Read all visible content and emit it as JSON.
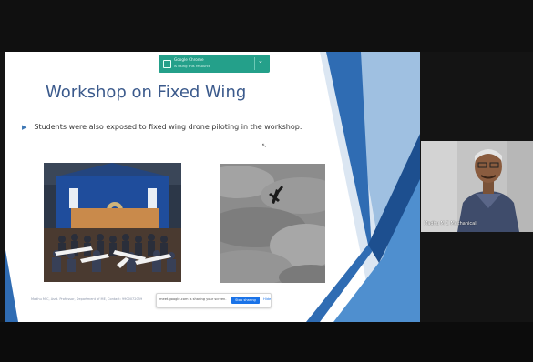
{
  "meeting": {
    "participant_name": "Madhu M C Mechanical"
  },
  "chrome_notice": {
    "app": "Google Chrome",
    "subtitle": "is using this resource"
  },
  "slide": {
    "title": "Workshop on Fixed Wing",
    "bullet": "Students were also exposed to fixed wing drone piloting in the workshop.",
    "footer": "Madhu M C, Asst. Professor, Department of ME, Contact: 9900072059"
  },
  "share_bar": {
    "message": "meet.google.com is sharing your screen.",
    "stop_label": "Stop sharing",
    "hide_label": "Hide"
  },
  "colors": {
    "title_blue": "#3b5a8c",
    "decor_blue": "#2f6cb3",
    "share_button": "#1a73e8",
    "chrome_green": "#24a08a"
  },
  "icons": {
    "bullet": "triangle-bullet-icon",
    "cursor": "mouse-cursor-icon",
    "chrome_notice": "window-icon"
  }
}
